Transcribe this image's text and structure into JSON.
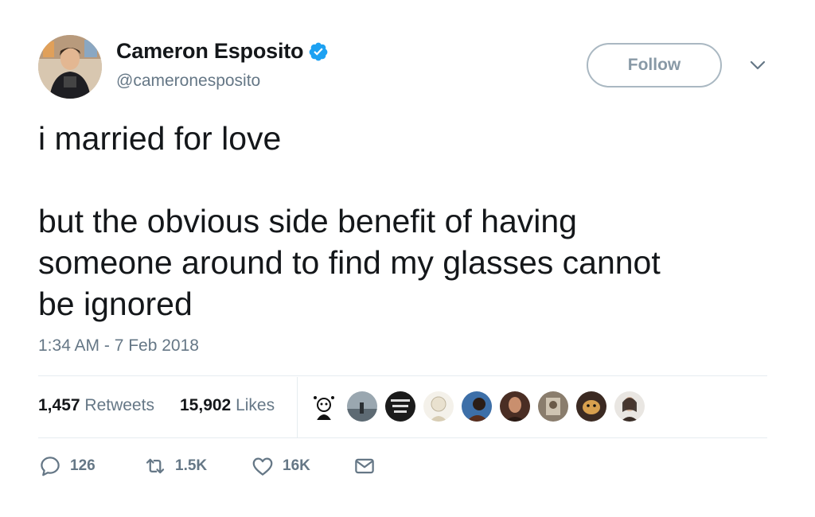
{
  "user": {
    "display_name": "Cameron Esposito",
    "handle": "@cameronesposito",
    "verified": true
  },
  "follow_label": "Follow",
  "tweet": {
    "text": "i married for love\n\nbut the obvious side benefit of having\nsomeone around to find my glasses cannot\nbe ignored",
    "timestamp": "1:34 AM - 7 Feb 2018"
  },
  "stats": {
    "retweets_count": "1,457",
    "retweets_label": "Retweets",
    "likes_count": "15,902",
    "likes_label": "Likes"
  },
  "likers": [
    "liker-avatar-1",
    "liker-avatar-2",
    "liker-avatar-3",
    "liker-avatar-4",
    "liker-avatar-5",
    "liker-avatar-6",
    "liker-avatar-7",
    "liker-avatar-8",
    "liker-avatar-9"
  ],
  "actions": {
    "reply_count": "126",
    "retweet_count": "1.5K",
    "like_count": "16K"
  },
  "icons": {
    "verified": "verified-badge-icon",
    "caret": "chevron-down-icon",
    "reply": "reply-icon",
    "retweet": "retweet-icon",
    "like": "heart-icon",
    "dm": "envelope-icon"
  },
  "colors": {
    "verified_blue": "#1da1f2",
    "text_primary": "#14171a",
    "text_secondary": "#657786",
    "border": "#e6ecf0"
  }
}
